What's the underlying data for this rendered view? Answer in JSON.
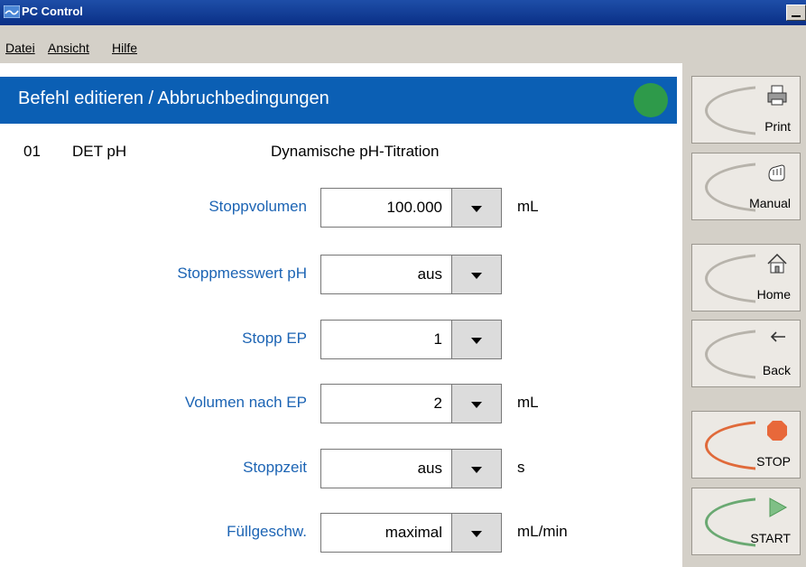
{
  "window": {
    "title": "PC Control"
  },
  "menu": {
    "items": [
      "Datei",
      "Ansicht",
      "Hilfe"
    ]
  },
  "header": {
    "title": "Befehl editieren / Abbruchbedingungen",
    "status_color": "#2e9a4a"
  },
  "command": {
    "number": "01",
    "name": "DET pH",
    "description": "Dynamische pH-Titration"
  },
  "params": [
    {
      "label": "Stoppvolumen",
      "value": "100.000",
      "unit": "mL"
    },
    {
      "label": "Stoppmesswert pH",
      "value": "aus",
      "unit": ""
    },
    {
      "label": "Stopp EP",
      "value": "1",
      "unit": ""
    },
    {
      "label": "Volumen nach EP",
      "value": "2",
      "unit": "mL"
    },
    {
      "label": "Stoppzeit",
      "value": "aus",
      "unit": "s"
    },
    {
      "label": "Füllgeschw.",
      "value": "maximal",
      "unit": "mL/min"
    }
  ],
  "sidebar": {
    "buttons": [
      {
        "label": "Print",
        "icon": "printer-icon"
      },
      {
        "label": "Manual",
        "icon": "hand-icon"
      },
      {
        "label": "Home",
        "icon": "home-icon"
      },
      {
        "label": "Back",
        "icon": "back-arrow-icon"
      },
      {
        "label": "STOP",
        "icon": "stop-icon"
      },
      {
        "label": "START",
        "icon": "play-icon"
      }
    ]
  },
  "colors": {
    "header_blue": "#0b5fb4",
    "label_blue": "#1c64b4",
    "stop": "#e06a3a",
    "start": "#6aa972"
  }
}
